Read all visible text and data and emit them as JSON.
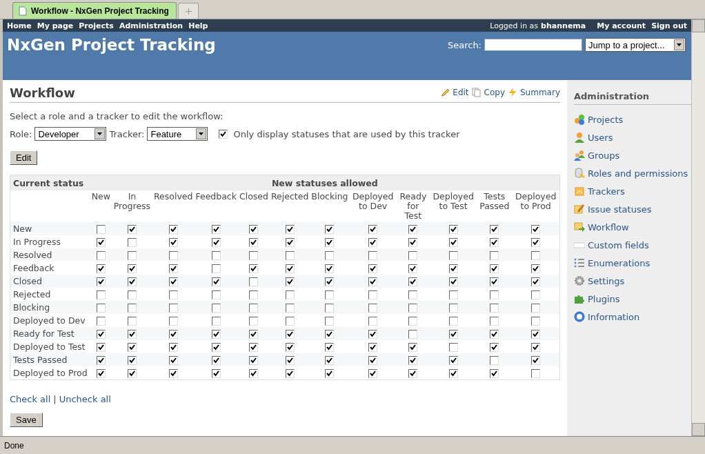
{
  "browser": {
    "tab_title": "Workflow - NxGen Project Tracking",
    "status": "Done"
  },
  "top_menu": {
    "items": [
      "Home",
      "My page",
      "Projects",
      "Administration",
      "Help"
    ],
    "logged_in_label": "Logged in as",
    "user": "bhannema",
    "account_items": [
      "My account",
      "Sign out"
    ]
  },
  "header": {
    "title": "NxGen Project Tracking",
    "search_label": "Search:",
    "jump_select": "Jump to a project..."
  },
  "page": {
    "title": "Workflow",
    "actions": [
      "Edit",
      "Copy",
      "Summary"
    ],
    "intro": "Select a role and a tracker to edit the workflow:",
    "role_label": "Role:",
    "role": "Developer",
    "tracker_label": "Tracker:",
    "tracker": "Feature",
    "only_used": {
      "label": "Only display statuses that are used by this tracker",
      "checked": true
    },
    "edit_button": "Edit"
  },
  "table": {
    "current_heading": "Current status",
    "new_heading": "New statuses allowed",
    "columns": [
      "New",
      "In Progress",
      "Resolved",
      "Feedback",
      "Closed",
      "Rejected",
      "Blocking",
      "Deployed to Dev",
      "Ready for Test",
      "Deployed to Test",
      "Tests Passed",
      "Deployed to Prod"
    ],
    "rows": [
      {
        "status": "New",
        "checked": [
          false,
          true,
          true,
          true,
          true,
          true,
          true,
          true,
          true,
          true,
          true,
          true
        ]
      },
      {
        "status": "In Progress",
        "checked": [
          true,
          false,
          true,
          true,
          true,
          true,
          true,
          true,
          true,
          true,
          true,
          true
        ]
      },
      {
        "status": "Resolved",
        "checked": [
          false,
          false,
          false,
          false,
          false,
          false,
          false,
          false,
          false,
          false,
          false,
          false
        ]
      },
      {
        "status": "Feedback",
        "checked": [
          true,
          true,
          true,
          false,
          true,
          true,
          true,
          true,
          true,
          true,
          true,
          true
        ]
      },
      {
        "status": "Closed",
        "checked": [
          true,
          true,
          true,
          true,
          false,
          true,
          true,
          true,
          true,
          true,
          true,
          true
        ]
      },
      {
        "status": "Rejected",
        "checked": [
          false,
          false,
          false,
          false,
          false,
          false,
          false,
          false,
          false,
          false,
          false,
          false
        ]
      },
      {
        "status": "Blocking",
        "checked": [
          false,
          false,
          false,
          false,
          false,
          false,
          false,
          false,
          false,
          false,
          false,
          false
        ]
      },
      {
        "status": "Deployed to Dev",
        "checked": [
          false,
          false,
          false,
          false,
          false,
          false,
          false,
          false,
          false,
          false,
          false,
          false
        ]
      },
      {
        "status": "Ready for Test",
        "checked": [
          true,
          true,
          true,
          true,
          true,
          true,
          true,
          true,
          false,
          true,
          true,
          true
        ]
      },
      {
        "status": "Deployed to Test",
        "checked": [
          true,
          true,
          true,
          true,
          true,
          true,
          true,
          true,
          true,
          false,
          true,
          true
        ]
      },
      {
        "status": "Tests Passed",
        "checked": [
          true,
          true,
          true,
          true,
          true,
          true,
          true,
          true,
          true,
          true,
          false,
          true
        ]
      },
      {
        "status": "Deployed to Prod",
        "checked": [
          true,
          true,
          true,
          true,
          true,
          true,
          true,
          true,
          true,
          true,
          true,
          false
        ]
      }
    ]
  },
  "check_all": "Check all",
  "separator": "|",
  "uncheck_all": "Uncheck all",
  "save_button": "Save",
  "sidebar": {
    "title": "Administration",
    "items": [
      {
        "label": "Projects",
        "kind": "projects"
      },
      {
        "label": "Users",
        "kind": "user"
      },
      {
        "label": "Groups",
        "kind": "group"
      },
      {
        "label": "Roles and permissions",
        "kind": "roles"
      },
      {
        "label": "Trackers",
        "kind": "tracker"
      },
      {
        "label": "Issue statuses",
        "kind": "status"
      },
      {
        "label": "Workflow",
        "kind": "workflow"
      },
      {
        "label": "Custom fields",
        "kind": "field"
      },
      {
        "label": "Enumerations",
        "kind": "list"
      },
      {
        "label": "Settings",
        "kind": "settings"
      },
      {
        "label": "Plugins",
        "kind": "plugin"
      },
      {
        "label": "Information",
        "kind": "info"
      }
    ]
  }
}
